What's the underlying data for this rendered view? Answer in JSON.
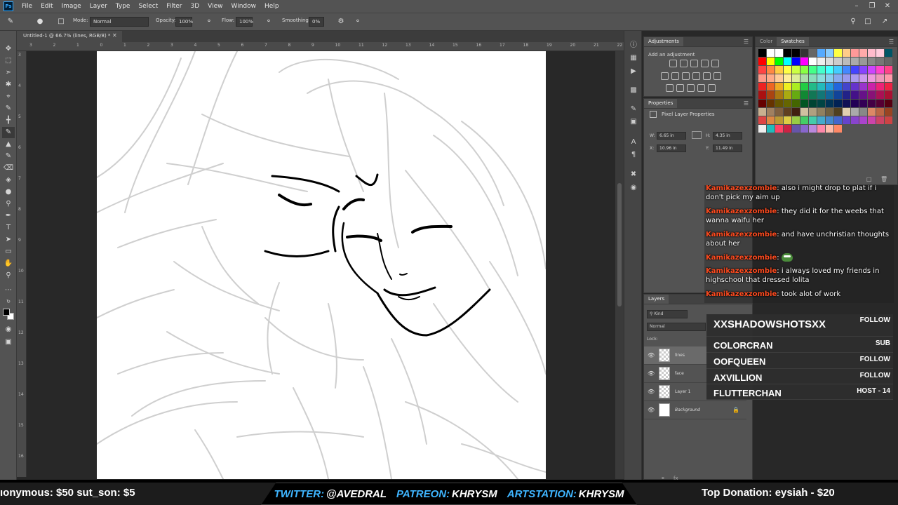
{
  "app": {
    "logo": "Ps",
    "menu": [
      "File",
      "Edit",
      "Image",
      "Layer",
      "Type",
      "Select",
      "Filter",
      "3D",
      "View",
      "Window",
      "Help"
    ]
  },
  "options": {
    "mode_label": "Mode:",
    "mode_value": "Normal",
    "opacity_label": "Opacity:",
    "opacity_value": "100%",
    "flow_label": "Flow:",
    "flow_value": "100%",
    "smoothing_label": "Smoothing:",
    "smoothing_value": "0%"
  },
  "document": {
    "tab_title": "Untitled-1 @ 66.7% (lines, RGB/8) *",
    "ruler_top": [
      "3",
      "2",
      "1",
      "0",
      "1",
      "2",
      "3",
      "4",
      "5",
      "6",
      "7",
      "8",
      "9",
      "10",
      "11",
      "12",
      "13",
      "14",
      "15",
      "16",
      "17",
      "18",
      "19",
      "20",
      "21",
      "22"
    ],
    "ruler_left": [
      "3",
      "4",
      "5",
      "6",
      "7",
      "8",
      "9",
      "10",
      "11",
      "12",
      "13",
      "14",
      "15",
      "16"
    ]
  },
  "adjustments": {
    "tab": "Adjustments",
    "add_label": "Add an adjustment"
  },
  "properties": {
    "tab": "Properties",
    "title": "Pixel Layer Properties",
    "w_label": "W:",
    "w_value": "6.65 in",
    "h_label": "H:",
    "h_value": "4.35 in",
    "x_label": "X:",
    "x_value": "10.96 in",
    "y_label": "Y:",
    "y_value": "11.49 in"
  },
  "swatches": {
    "tab_color": "Color",
    "tab_swatches": "Swatches",
    "colors": [
      "#000000",
      "#ffffff",
      "#ffffff",
      "#000000",
      "#000000",
      "#333333",
      "#666666",
      "#55aaff",
      "#88ccff",
      "#ffff44",
      "#ffcc88",
      "#ff9999",
      "#ffaaaa",
      "#ffbbcc",
      "#ffccdd",
      "#005566",
      "#ff0000",
      "#ffff00",
      "#00ff00",
      "#00ffff",
      "#0000ff",
      "#ff00ff",
      "#ffffff",
      "#eeeeee",
      "#dddddd",
      "#cccccc",
      "#bbbbbb",
      "#aaaaaa",
      "#999999",
      "#888888",
      "#777777",
      "#666666",
      "#ff4444",
      "#ff8844",
      "#ffcc44",
      "#ffff44",
      "#ccff44",
      "#88ff44",
      "#44ff88",
      "#44ffcc",
      "#44ffff",
      "#44ccff",
      "#4488ff",
      "#4444ff",
      "#8844ff",
      "#cc44ff",
      "#ff44cc",
      "#ff4488",
      "#ff9988",
      "#ffaa88",
      "#ffcc99",
      "#ffee99",
      "#ddee99",
      "#aaddaa",
      "#88ddbb",
      "#88dddd",
      "#88ccee",
      "#88aaee",
      "#9999ee",
      "#aa99ee",
      "#cc99ee",
      "#ee99dd",
      "#ee99bb",
      "#ff99aa",
      "#ee2222",
      "#ee6622",
      "#eeaa22",
      "#eeee22",
      "#aaee22",
      "#22cc44",
      "#22bb88",
      "#22bbbb",
      "#2299dd",
      "#2266dd",
      "#4444cc",
      "#6633cc",
      "#9933cc",
      "#cc22aa",
      "#ee2277",
      "#ee2244",
      "#aa1111",
      "#aa4411",
      "#aa7711",
      "#aaaa11",
      "#66aa11",
      "#118833",
      "#117755",
      "#117777",
      "#116699",
      "#114499",
      "#222288",
      "#441188",
      "#661188",
      "#881177",
      "#aa1155",
      "#aa1133",
      "#660000",
      "#663300",
      "#665500",
      "#666600",
      "#446600",
      "#005522",
      "#004433",
      "#004444",
      "#003355",
      "#002255",
      "#111155",
      "#220055",
      "#330055",
      "#440044",
      "#550033",
      "#550011",
      "#c8b090",
      "#a08060",
      "#806040",
      "#604020",
      "#402010",
      "#d0c0a0",
      "#b0a080",
      "#908060",
      "#706040",
      "#504020",
      "#e0d0b0",
      "#aaaaaa",
      "#888888",
      "#dd8866",
      "#bb6644",
      "#994422",
      "#dd4444",
      "#dd8844",
      "#bb9933",
      "#ddcc44",
      "#99cc44",
      "#44cc66",
      "#44ccaa",
      "#44aacc",
      "#4488cc",
      "#4466cc",
      "#6644cc",
      "#8844cc",
      "#aa44cc",
      "#cc44aa",
      "#cc4466",
      "#cc4444",
      "#eeeeee",
      "#22bbbb",
      "#ff4466",
      "#cc2244",
      "#6655aa",
      "#8866cc",
      "#bb88dd",
      "#ff88aa",
      "#ffbbaa",
      "#ff8866"
    ]
  },
  "layers": {
    "tab": "Layers",
    "filter_label": "Kind",
    "blend_mode": "Normal",
    "lock_label": "Lock:",
    "items": [
      {
        "name": "lines",
        "selected": true,
        "italic": false,
        "solid": false,
        "locked": false
      },
      {
        "name": "face",
        "selected": false,
        "italic": false,
        "solid": false,
        "locked": false
      },
      {
        "name": "Layer 1",
        "selected": false,
        "italic": false,
        "solid": false,
        "locked": false
      },
      {
        "name": "Background",
        "selected": false,
        "italic": true,
        "solid": true,
        "locked": true
      }
    ]
  },
  "chat": {
    "messages": [
      {
        "user": "Kamikazexzombie",
        "text": "also i might drop to plat if i don't pick my aim up"
      },
      {
        "user": "Kamikazexzombie",
        "text": "they did it for the weebs that wanna waifu her"
      },
      {
        "user": "Kamikazexzombie",
        "text": "and have unchristian thoughts about her"
      },
      {
        "user": "Kamikazexzombie",
        "text": "",
        "emote": "pepe-emote"
      },
      {
        "user": "Kamikazexzombie",
        "text": "i always loved my friends in highschool that dressed lolita"
      },
      {
        "user": "Kamikazexzombie",
        "text": "took alot of work"
      }
    ]
  },
  "events": {
    "rows": [
      {
        "name": "XXSHADOWSHOTSXX",
        "type": "FOLLOW"
      },
      {
        "name": "COLORCRAN",
        "type": "SUB"
      },
      {
        "name": "OOFQUEEN",
        "type": "FOLLOW"
      },
      {
        "name": "AXVILLION",
        "type": "FOLLOW"
      },
      {
        "name": "FLUTTERCHAN",
        "type": "HOST - 14"
      }
    ]
  },
  "bottom": {
    "ticker": "ıonymous: $50    sut_son: $5",
    "twitter_label": "TWITTER:",
    "twitter_value": "@AVEDRAL",
    "patreon_label": "PATREON:",
    "patreon_value": "KHRYSM",
    "artstation_label": "ARTSTATION:",
    "artstation_value": "KHRYSM",
    "top_donation": "Top Donation: eysiah - $20"
  }
}
